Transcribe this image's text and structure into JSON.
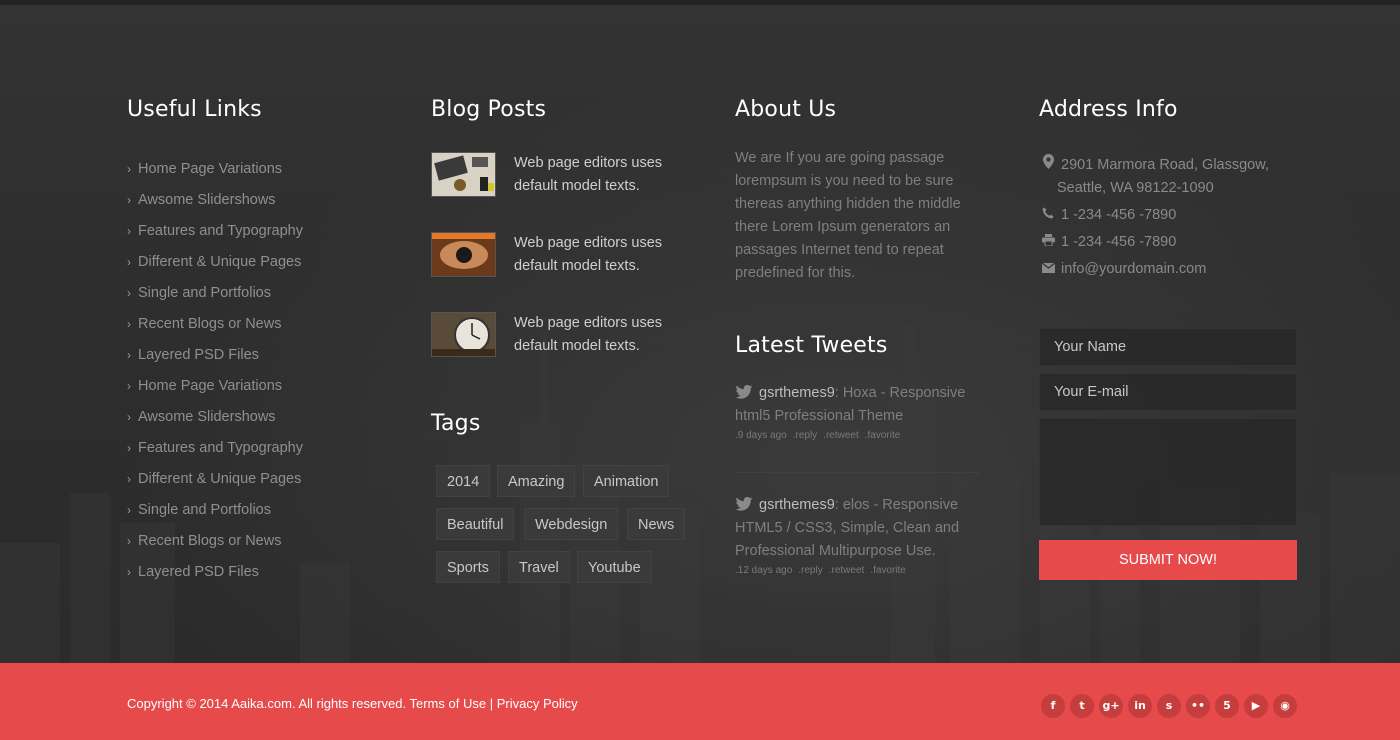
{
  "useful_links": {
    "title": "Useful Links",
    "items": [
      "Home Page Variations",
      "Awsome Slidershows",
      "Features and Typography",
      "Different & Unique Pages",
      "Single and Portfolios",
      "Recent Blogs or News",
      "Layered PSD Files",
      "Home Page Variations",
      "Awsome Slidershows",
      "Features and Typography",
      "Different & Unique Pages",
      "Single and Portfolios",
      "Recent Blogs or News",
      "Layered PSD Files"
    ]
  },
  "blog_posts": {
    "title": "Blog Posts",
    "items": [
      {
        "text": "Web page editors uses default model texts.",
        "thumb": "desk-thumbnail"
      },
      {
        "text": "Web page editors uses default model texts.",
        "thumb": "hands-thumbnail"
      },
      {
        "text": "Web page editors uses default model texts.",
        "thumb": "clock-thumbnail"
      }
    ]
  },
  "tags": {
    "title": "Tags",
    "items": [
      "2014",
      "Amazing",
      "Animation",
      "Beautiful",
      "Webdesign",
      "News",
      "Sports",
      "Travel",
      "Youtube"
    ]
  },
  "about": {
    "title": "About Us",
    "text": "We are If you are going passage lorempsum is you need to be sure thereas anything hidden the middle there Lorem Ipsum generators an passages Internet tend to repeat predefined for this."
  },
  "tweets": {
    "title": "Latest Tweets",
    "items": [
      {
        "user": "gsrthemes9",
        "text": ": Hoxa - Responsive html5 Professional Theme",
        "time": ".9 days ago",
        "reply": ".reply",
        "retweet": ".retweet",
        "favorite": ".favorite"
      },
      {
        "user": "gsrthemes9",
        "text": ": elos - Responsive HTML5 / CSS3, Simple, Clean and Professional Multipurpose Use.",
        "time": ".12 days ago",
        "reply": ".reply",
        "retweet": ".retweet",
        "favorite": ".favorite"
      }
    ]
  },
  "address": {
    "title": "Address Info",
    "street": "2901 Marmora Road, Glassgow,",
    "city": "Seattle, WA 98122-1090",
    "phone": "1 -234 -456 -7890",
    "fax": "1 -234 -456 -7890",
    "email": "info@yourdomain.com"
  },
  "form": {
    "name_placeholder": "Your Name",
    "email_placeholder": "Your E-mail",
    "message_placeholder": "",
    "submit_label": "SUBMIT NOW!"
  },
  "bottom": {
    "copyright": "Copyright © 2014 Aaika.com. All rights reserved.",
    "terms": "Terms of Use",
    "separator": "|",
    "privacy": "Privacy Policy",
    "social": [
      {
        "name": "facebook-icon",
        "glyph": "f"
      },
      {
        "name": "twitter-icon",
        "glyph": "t"
      },
      {
        "name": "google-plus-icon",
        "glyph": "g+"
      },
      {
        "name": "linkedin-icon",
        "glyph": "in"
      },
      {
        "name": "skype-icon",
        "glyph": "s"
      },
      {
        "name": "flickr-icon",
        "glyph": "••"
      },
      {
        "name": "html5-icon",
        "glyph": "5"
      },
      {
        "name": "youtube-icon",
        "glyph": "▶"
      },
      {
        "name": "rss-icon",
        "glyph": "◉"
      }
    ]
  },
  "colors": {
    "accent": "#e64a4a",
    "background": "#2f2f2f"
  }
}
